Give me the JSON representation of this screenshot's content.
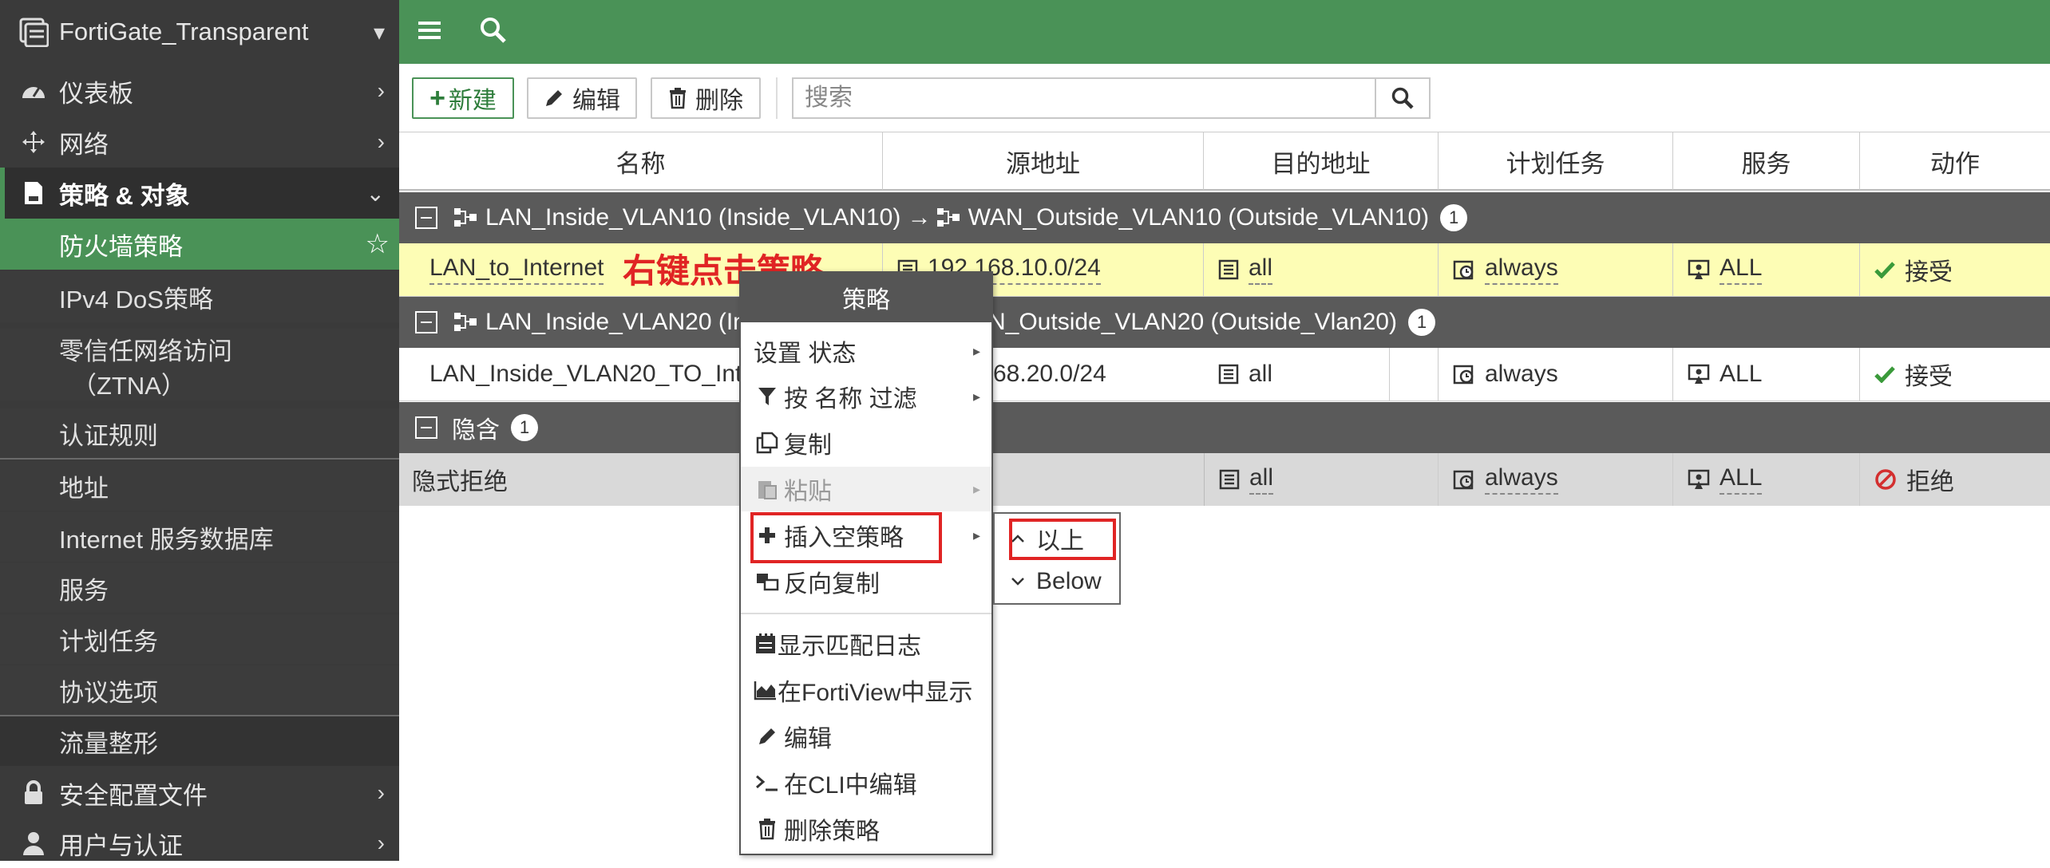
{
  "sidebar": {
    "device": "FortiGate_Transparent",
    "items": [
      {
        "label": "仪表板",
        "icon": "dashboard-icon"
      },
      {
        "label": "网络",
        "icon": "network-icon"
      },
      {
        "label": "策略 & 对象",
        "icon": "policy-icon"
      },
      {
        "label": "安全配置文件",
        "icon": "lock-icon"
      },
      {
        "label": "用户与认证",
        "icon": "user-icon"
      }
    ],
    "subitems": [
      "防火墙策略",
      "IPv4 DoS策略",
      "零信任网络访问",
      "（ZTNA）",
      "认证规则",
      "地址",
      "Internet 服务数据库",
      "服务",
      "计划任务",
      "协议选项",
      "流量整形"
    ]
  },
  "toolbar": {
    "new_label": "新建",
    "edit_label": "编辑",
    "delete_label": "删除",
    "search_placeholder": "搜索"
  },
  "table": {
    "headers": [
      "名称",
      "源地址",
      "目的地址",
      "计划任务",
      "服务",
      "动作"
    ],
    "groups": [
      {
        "label": "LAN_Inside_VLAN10 (Inside_VLAN10) →",
        "dest": "WAN_Outside_VLAN10 (Outside_VLAN10)",
        "count": "1"
      },
      {
        "label": "LAN_Inside_VLAN20 (In",
        "dest": "N_Outside_VLAN20 (Outside_Vlan20)",
        "count": "1"
      },
      {
        "label": "隐含",
        "count": "1"
      }
    ],
    "rows": [
      {
        "name": "LAN_to_Internet",
        "src": "192.168.10.0/24",
        "dst": "all",
        "schedule": "always",
        "service": "ALL",
        "action": "接受"
      },
      {
        "name": "LAN_Inside_VLAN20_TO_Inte",
        "src": "68.20.0/24",
        "dst": "all",
        "schedule": "always",
        "service": "ALL",
        "action": "接受"
      },
      {
        "name": "隐式拒绝",
        "dst": "all",
        "schedule": "always",
        "service": "ALL",
        "action": "拒绝"
      }
    ]
  },
  "annotation": "右键点击策略",
  "context_menu": {
    "title": "策略",
    "items": [
      "设置 状态",
      "按 名称 过滤",
      "复制",
      "粘贴",
      "插入空策略",
      "反向复制",
      "显示匹配日志",
      "在FortiView中显示",
      "编辑",
      "在CLI中编辑",
      "删除策略"
    ]
  },
  "submenu": {
    "above": "以上",
    "below": "Below"
  },
  "colors": {
    "accent_green": "#4a9257",
    "selected_row": "#fdfdb5",
    "annotation_red": "#e02424"
  }
}
